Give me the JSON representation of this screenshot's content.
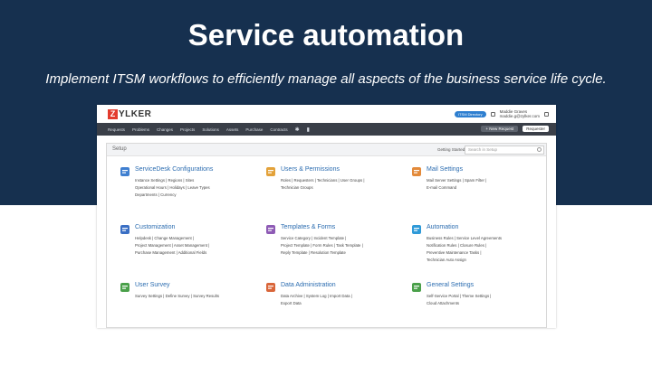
{
  "slide": {
    "title": "Service automation",
    "subtitle": "Implement ITSM workflows to efficiently manage all aspects of the business service life cycle."
  },
  "app": {
    "logo_mark": "Z",
    "logo_text": "YLKER",
    "top_pill": "ITSM Directory",
    "user_name": "Maddie Graves",
    "user_email": "maddie.g@zylker.com",
    "nav": [
      "Requests",
      "Problems",
      "Changes",
      "Projects",
      "Solutions",
      "Assets",
      "Purchase",
      "Contracts"
    ],
    "new_button": "+ New Request",
    "requester_button": "Requester",
    "setup_label": "Setup",
    "getting_started": "Getting Started",
    "search_placeholder": "Search in Setup"
  },
  "cards": [
    {
      "title": "ServiceDesk Configurations",
      "lines": [
        "Instance Settings | Regions | Sites",
        "Operational Hours | Holidays | Leave Types",
        "Departments | Currency"
      ],
      "icon": "wrench-gear-icon",
      "color": "#3f7fd0"
    },
    {
      "title": "Users & Permissions",
      "lines": [
        "Roles | Requesters | Technicians | User Groups |",
        "Technician Groups"
      ],
      "icon": "users-icon",
      "color": "#e3a23a"
    },
    {
      "title": "Mail Settings",
      "lines": [
        "Mail Server Settings | Spam Filter |",
        "E-mail Command"
      ],
      "icon": "mail-icon",
      "color": "#e38a3a"
    },
    {
      "title": "Customization",
      "lines": [
        "Helpdesk | Change Management |",
        "Project Management | Asset Management |",
        "Purchase Management | Additional Fields"
      ],
      "icon": "pencil-ruler-icon",
      "color": "#3a6fc4"
    },
    {
      "title": "Templates & Forms",
      "lines": [
        "Service Category | Incident Template |",
        "Project Template | Form Rules | Task Template |",
        "Reply Template | Resolution Template"
      ],
      "icon": "templates-icon",
      "color": "#8e5bb5"
    },
    {
      "title": "Automation",
      "lines": [
        "Business Rules | Service Level Agreements",
        "Notification Rules | Closure Rules |",
        "Preventive Maintenance Tasks |",
        "Technician Auto Assign"
      ],
      "icon": "gears-icon",
      "color": "#2f9ad8"
    },
    {
      "title": "User Survey",
      "lines": [
        "Survey Settings | Define Survey | Survey Results"
      ],
      "icon": "survey-icon",
      "color": "#4aa04a"
    },
    {
      "title": "Data Administration",
      "lines": [
        "Data Archive | System Log | Import Data |",
        "Export Data"
      ],
      "icon": "database-icon",
      "color": "#d9663a"
    },
    {
      "title": "General Settings",
      "lines": [
        "Self-Service Portal | Theme Settings |",
        "Cloud Attachments"
      ],
      "icon": "settings-icon",
      "color": "#4aa04a"
    }
  ]
}
